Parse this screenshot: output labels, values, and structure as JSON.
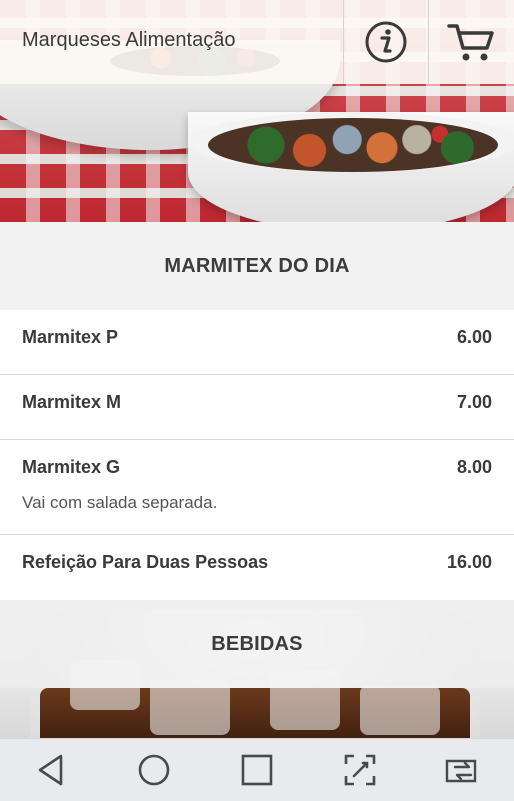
{
  "app": {
    "title": "Marqueses Alimentação"
  },
  "topbar": {
    "info_icon": "info-icon",
    "cart_icon": "cart-icon"
  },
  "sections": [
    {
      "title": "MARMITEX DO DIA",
      "items": [
        {
          "name": "Marmitex P",
          "price": "6.00",
          "description": ""
        },
        {
          "name": "Marmitex M",
          "price": "7.00",
          "description": ""
        },
        {
          "name": "Marmitex G",
          "price": "8.00",
          "description": "Vai com salada separada."
        },
        {
          "name": "Refeição Para Duas Pessoas",
          "price": "16.00",
          "description": ""
        }
      ]
    },
    {
      "title": "BEBIDAS",
      "items": []
    }
  ],
  "navbar": {
    "icons": [
      "back-icon",
      "home-icon",
      "recents-icon",
      "screen-edit-icon",
      "switch-screen-icon"
    ]
  },
  "colors": {
    "accent": "#c92a32",
    "icon": "#3a3a3a",
    "nav": "#e9eaee"
  }
}
